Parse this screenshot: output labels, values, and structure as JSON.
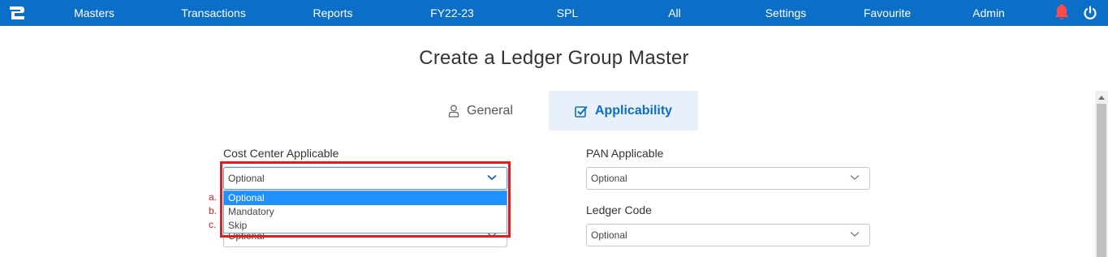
{
  "nav": {
    "items": [
      "Masters",
      "Transactions",
      "Reports",
      "FY22-23",
      "SPL",
      "All",
      "Settings",
      "Favourite",
      "Admin"
    ],
    "icons": {
      "logo": "app-logo-icon",
      "bell": "bell-icon",
      "power": "power-icon"
    },
    "color": "#0b6fc7",
    "bell_color": "#ff4a4a"
  },
  "page": {
    "title": "Create a Ledger Group Master"
  },
  "tabs": [
    {
      "label": "General",
      "icon": "user-icon",
      "active": false
    },
    {
      "label": "Applicability",
      "icon": "checkbox-icon",
      "active": true
    }
  ],
  "form": {
    "cost_center": {
      "label": "Cost Center Applicable",
      "value": "Optional",
      "options": [
        "Optional",
        "Mandatory",
        "Skip"
      ],
      "markers": [
        "a.",
        "b.",
        "c."
      ]
    },
    "hidden_field": {
      "value": "Optional"
    },
    "pan": {
      "label": "PAN Applicable",
      "value": "Optional"
    },
    "ledger_code": {
      "label": "Ledger Code",
      "value": "Optional"
    }
  },
  "colors": {
    "highlight": "#e21d1d",
    "option_selected": "#1e90ff",
    "tab_active_bg": "#e8f1fb"
  }
}
